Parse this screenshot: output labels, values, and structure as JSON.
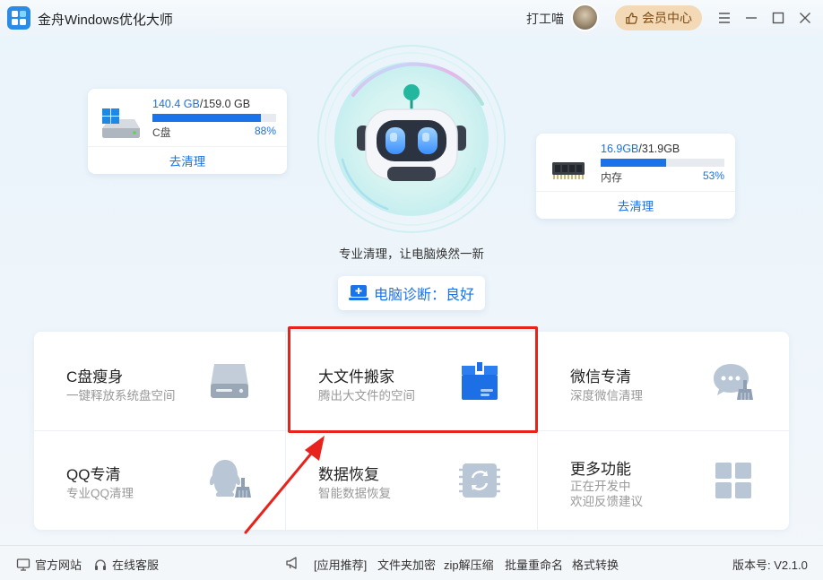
{
  "app": {
    "title": "金舟Windows优化大师"
  },
  "header": {
    "user_name": "打工喵",
    "vip_label": "会员中心"
  },
  "disk": {
    "used": "140.4 GB",
    "total": "/159.0 GB",
    "label": "C盘",
    "percent_text": "88%",
    "percent": 88,
    "action": "去清理"
  },
  "memory": {
    "used": "16.9GB",
    "total": "/31.9GB",
    "label": "内存",
    "percent_text": "53%",
    "percent": 53,
    "action": "去清理"
  },
  "hero": {
    "slogan": "专业清理，让电脑焕然一新",
    "diagnosis": "电脑诊断：良好"
  },
  "features": [
    {
      "title": "C盘瘦身",
      "subtitle": "一键释放系统盘空间",
      "icon": "disk-slim-icon"
    },
    {
      "title": "大文件搬家",
      "subtitle": "腾出大文件的空间",
      "icon": "moving-box-icon"
    },
    {
      "title": "微信专清",
      "subtitle": "深度微信清理",
      "icon": "wechat-clean-icon"
    },
    {
      "title": "QQ专清",
      "subtitle": "专业QQ清理",
      "icon": "qq-clean-icon"
    },
    {
      "title": "数据恢复",
      "subtitle": "智能数据恢复",
      "icon": "data-recovery-icon"
    },
    {
      "title": "更多功能",
      "subtitle": "正在开发中",
      "subtitle2": "欢迎反馈建议",
      "icon": "more-grid-icon"
    }
  ],
  "footer": {
    "website": "官方网站",
    "support": "在线客服",
    "recommend": "[应用推荐]",
    "links": [
      "文件夹加密",
      "zip解压缩",
      "批量重命名",
      "格式转换"
    ],
    "version": "版本号: V2.1.0"
  },
  "colors": {
    "accent": "#1a73e8",
    "highlight": "#e8231b",
    "vip_bg": "#f3d9b5"
  }
}
